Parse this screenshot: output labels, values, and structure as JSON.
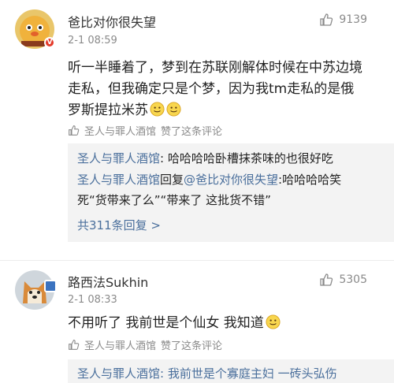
{
  "comments": [
    {
      "username": "爸比对你很失望",
      "time": "2-1 08:59",
      "likes": "9139",
      "avatar_icon": "chick-avatar-icon",
      "body_lines": [
        "听一半睡着了，梦到在苏联刚解体时候在中苏边境",
        "走私，但我确定只是个梦，因为我tm走私的是俄",
        "罗斯提拉米苏"
      ],
      "liked_by": "圣人与罪人酒馆",
      "liked_suffix": "赞了这条评论",
      "replies": [
        {
          "author": "圣人与罪人酒馆",
          "text": ": 哈哈哈哈卧槽抹茶味的也很好吃"
        },
        {
          "author": "圣人与罪人酒馆",
          "mid": "回复",
          "mention": "@爸比对你很失望",
          "text": ":哈哈哈哈笑",
          "text2": "死“货带来了么”“带来了 这批货不错”"
        }
      ],
      "more_replies": "共311条回复 >"
    },
    {
      "username": "路西法Sukhin",
      "time": "2-1 08:33",
      "likes": "5305",
      "avatar_icon": "shiba-avatar-icon",
      "body_line": "不用听了 我前世是个仙女 我知道",
      "liked_by": "圣人与罪人酒馆",
      "liked_suffix": "赞了这条评论",
      "reply_partial": "圣人与罪人酒馆: 我前世是个寡庭主妇 一砖头弘伤"
    }
  ],
  "colors": {
    "link": "#4a6f9c",
    "meta": "#8a8a8a",
    "reply_bg": "#f3f3f3"
  }
}
